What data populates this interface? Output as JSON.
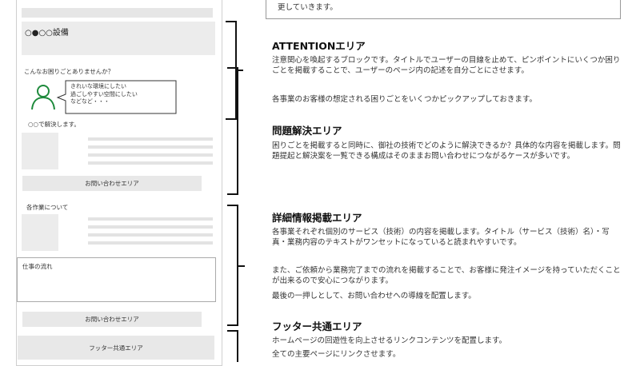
{
  "wireframe": {
    "main_visual_title": "○●○○設備",
    "problem_question": "こんなお困りごとありませんか？",
    "bubble_text": "きれいな環境にしたい\n過ごしやすい空間にしたい\nなどなど・・・",
    "solve_text": "○○で解決します。",
    "contact_label_1": "お問い合わせエリア",
    "about_label": "各作業について",
    "flow_label": "仕事の流れ",
    "contact_label_2": "お問い合わせエリア",
    "footer_label": "フッター共通エリア"
  },
  "descriptions": {
    "top_partial": "更していきます。",
    "attention": {
      "heading": "ATTENTIONエリア",
      "body": "注意関心を喚起するブロックです。タイトルでユーザーの目線を止めて、ピンポイントにいくつか困りごとを掲載することで、ユーザーのページ内の記述を自分ごとにさせます。",
      "body2": "各事業のお客様の想定される困りごとをいくつかピックアップしておきます。"
    },
    "problem": {
      "heading": "問題解決エリア",
      "body": "困りごとを掲載すると同時に、御社の技術でどのように解決できるか？具体的な内容を掲載します。問題提起と解決案を一覧できる構成はそのままお問い合わせにつながるケースが多いです。"
    },
    "detail": {
      "heading": "詳細情報掲載エリア",
      "body": "各事業それぞれ個別のサービス（技術）の内容を掲載します。タイトル（サービス（技術）名）・写真・業務内容のテキストがワンセットになっていると読まれやすいです。",
      "body2": "また、ご依頼から業務完了までの流れを掲載することで、お客様に発注イメージを持っていただくことが出来るので安心につながります。",
      "body3": "最後の一押しとして、お問い合わせへの導線を配置します。"
    },
    "footer": {
      "heading": "フッター共通エリア",
      "body": "ホームページの回遊性を向上させるリンクコンテンツを配置します。",
      "body2": "全ての主要ページにリンクさせます。"
    }
  }
}
